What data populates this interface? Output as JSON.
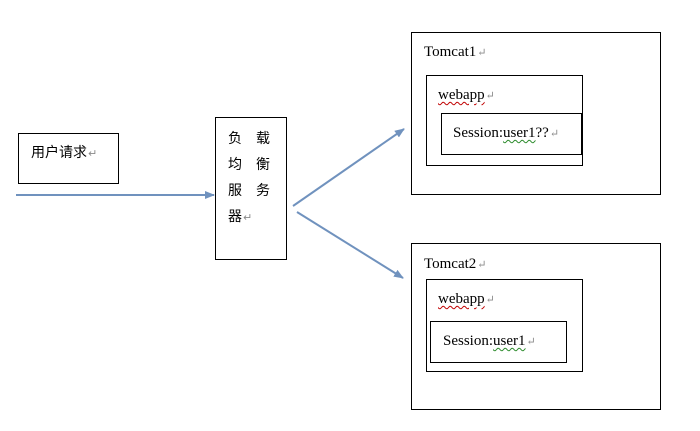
{
  "user_request": {
    "text": "用户请求"
  },
  "load_balancer": {
    "chars": [
      "负",
      "载",
      "均",
      "衡",
      "服",
      "务",
      "器"
    ]
  },
  "tomcat1": {
    "title": "Tomcat1",
    "webapp": "webapp",
    "session_prefix": "Session:",
    "session_user": "user1",
    "session_suffix": "??"
  },
  "tomcat2": {
    "title": "Tomcat2",
    "webapp": "webapp",
    "session_prefix": "Session:",
    "session_user": "user1",
    "session_suffix": ""
  },
  "para_mark": "↵",
  "colors": {
    "arrow": "#7092BE",
    "border": "#000000"
  }
}
